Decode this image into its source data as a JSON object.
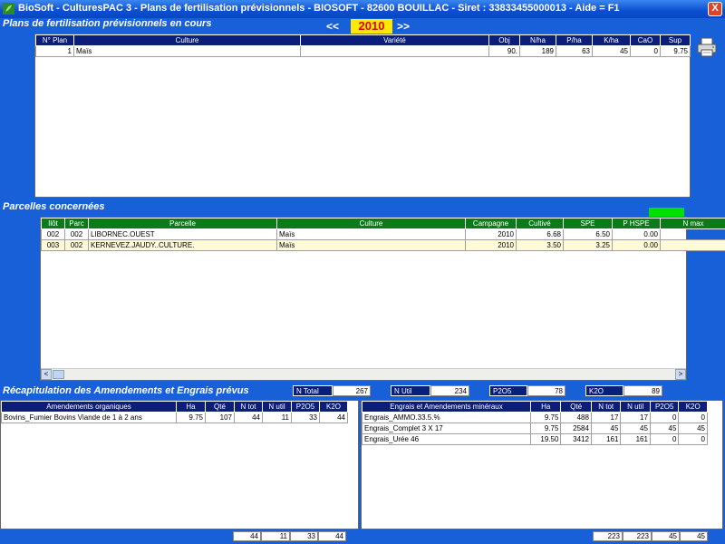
{
  "window": {
    "title": "BioSoft - CulturesPAC 3 - Plans de fertilisation prévisionnels    - BIOSOFT - 82600 BOUILLAC - Siret : 33833455000013 - Aide = F1",
    "close_label": "X"
  },
  "plans": {
    "section_title": "Plans de fertilisation prévisionnels en cours",
    "year_prev": "<<",
    "year": "2010",
    "year_next": ">>",
    "headers": [
      "N° Plan",
      "Culture",
      "Variété",
      "Obj",
      "N/ha",
      "P/ha",
      "K/ha",
      "CaO",
      "Sup"
    ],
    "rows": [
      [
        "1",
        "Maïs",
        "",
        "90.",
        "189",
        "63",
        "45",
        "0",
        "9.75"
      ]
    ]
  },
  "parcelles": {
    "section_title": "Parcelles concernées",
    "headers": [
      "Ilôt",
      "Parc",
      "Parcelle",
      "Culture",
      "Campagne",
      "Cultivé",
      "SPE",
      "P HSPE",
      "N max"
    ],
    "rows": [
      [
        "002",
        "002",
        "LIBORNEC.OUEST",
        "Maïs",
        "2010",
        "6.68",
        "6.50",
        "0.00",
        ""
      ],
      [
        "003",
        "002",
        "KERNEVEZ.JAUDY..CULTURE.",
        "Maïs",
        "2010",
        "3.50",
        "3.25",
        "0.00",
        ""
      ]
    ],
    "scroll_left": "<",
    "scroll_right": ">"
  },
  "recap": {
    "section_title": "Récapitulation des Amendements et Engrais prévus",
    "totals": [
      {
        "label": "N Total",
        "value": "267"
      },
      {
        "label": "N Util",
        "value": "234"
      },
      {
        "label": "P2O5",
        "value": "78"
      },
      {
        "label": "K2O",
        "value": "89"
      }
    ],
    "organic": {
      "headers": [
        "Amendements organiques",
        "Ha",
        "Qté",
        "N tot",
        "N util",
        "P2O5",
        "K2O"
      ],
      "rows": [
        [
          "Bovins_Fumier Bovins Viande de 1 à 2 ans",
          "9.75",
          "107",
          "44",
          "11",
          "33",
          "44"
        ]
      ],
      "footer": [
        "44",
        "11",
        "33",
        "44"
      ]
    },
    "mineral": {
      "headers": [
        "Engrais et Amendements minéraux",
        "Ha",
        "Qté",
        "N tot",
        "N util",
        "P2O5",
        "K2O"
      ],
      "rows": [
        [
          "Engrais_AMMO.33.5.%",
          "9.75",
          "488",
          "17",
          "17",
          "0",
          "0"
        ],
        [
          "Engrais_Complet 3 X 17",
          "9.75",
          "2584",
          "45",
          "45",
          "45",
          "45"
        ],
        [
          "Engrais_Urée 46",
          "19.50",
          "3412",
          "161",
          "161",
          "0",
          "0"
        ]
      ],
      "footer": [
        "223",
        "223",
        "45",
        "45"
      ]
    }
  },
  "icons": {
    "printer": "printer-icon",
    "app": "app-icon"
  },
  "colors": {
    "background": "#1760d8",
    "header_navy": "#0a1e7a",
    "header_green": "#0d7a1a",
    "year_bg": "#ffea00",
    "year_text": "#e00000",
    "status_green": "#00e000"
  }
}
